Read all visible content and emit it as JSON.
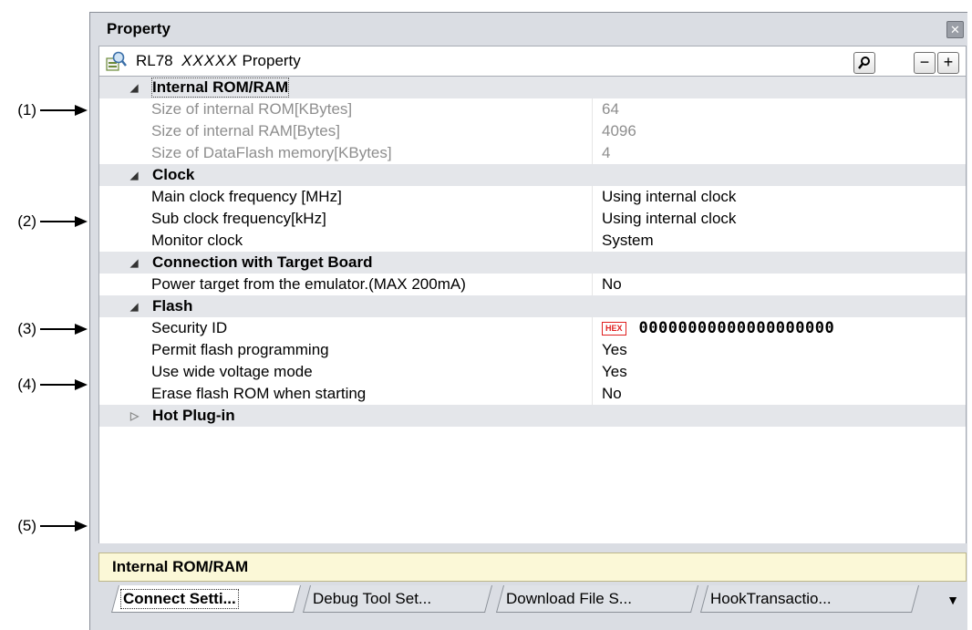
{
  "annotations": [
    "(1)",
    "(2)",
    "(3)",
    "(4)",
    "(5)"
  ],
  "panel": {
    "title": "Property",
    "close_symbol": "✕",
    "property_name_prefix": "RL78",
    "property_name_device": "XXXXX",
    "property_name_suffix": "Property",
    "buttons": {
      "search_icon": "magnifier-icon",
      "collapse": "−",
      "expand": "+"
    }
  },
  "categories": {
    "internal": {
      "label": "Internal ROM/RAM",
      "expanded": true
    },
    "clock": {
      "label": "Clock",
      "expanded": true
    },
    "connection": {
      "label": "Connection with Target Board",
      "expanded": true
    },
    "flash": {
      "label": "Flash",
      "expanded": true
    },
    "hotplug": {
      "label": "Hot Plug-in",
      "expanded": false
    }
  },
  "rows": {
    "rom_size": {
      "name": "Size of internal ROM[KBytes]",
      "value": "64"
    },
    "ram_size": {
      "name": "Size of internal RAM[Bytes]",
      "value": "4096"
    },
    "dataflash_size": {
      "name": "Size of DataFlash memory[KBytes]",
      "value": "4"
    },
    "main_clock": {
      "name": "Main clock frequency [MHz]",
      "value": "Using internal clock"
    },
    "sub_clock": {
      "name": "Sub clock frequency[kHz]",
      "value": "Using internal clock"
    },
    "monitor_clock": {
      "name": "Monitor clock",
      "value": "System"
    },
    "power_target": {
      "name": "Power target from the emulator.(MAX 200mA)",
      "value": "No"
    },
    "security_id": {
      "name": "Security ID",
      "badge": "HEX",
      "value": "00000000000000000000"
    },
    "permit_flash": {
      "name": "Permit flash programming",
      "value": "Yes"
    },
    "wide_voltage": {
      "name": "Use wide voltage mode",
      "value": "Yes"
    },
    "erase_flash": {
      "name": "Erase flash ROM when starting",
      "value": "No"
    }
  },
  "description": "Internal ROM/RAM",
  "tabs": [
    "Connect Setti...",
    "Debug Tool Set...",
    "Download File S...",
    "HookTransactio..."
  ],
  "tab_menu_symbol": "▼",
  "colors": {
    "category_bg": "#e4e6ea",
    "description_bg": "#fbf8d7",
    "hex_badge": "#e02020",
    "readonly_text": "#8e8e8e"
  }
}
